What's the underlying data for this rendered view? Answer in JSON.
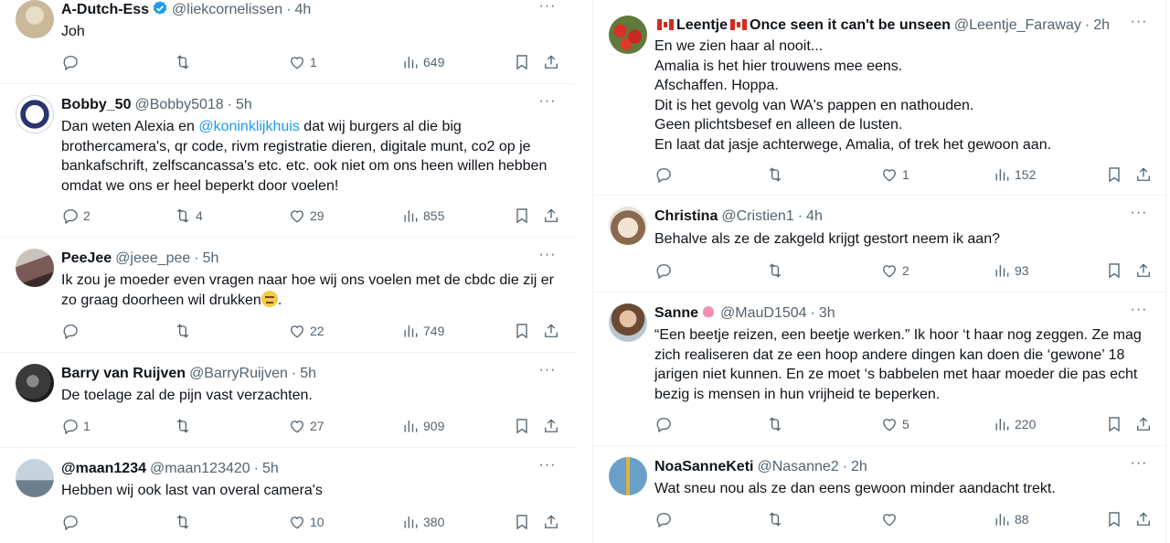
{
  "left_column": {
    "tweets": [
      {
        "name": "A-Dutch-Ess",
        "verified": true,
        "handle": "@liekcornelissen",
        "time": "4h",
        "text": "Joh",
        "replies": "",
        "retweets": "",
        "likes": "1",
        "views": "649",
        "avatar_color": "#c9b89a"
      },
      {
        "name": "Bobby_50",
        "handle": "@Bobby5018",
        "time": "5h",
        "text_before": "Dan weten Alexia en ",
        "mention": "@koninklijkhuis",
        "text_after": " dat wij burgers al die big\nbrothercamera's, qr code, rivm registratie dieren, digitale munt, co2 op je\nbankafschrift, zelfscancassa's etc. etc. ook niet om ons heen willen hebben\nomdat we ons er heel beperkt door voelen!",
        "replies": "2",
        "retweets": "4",
        "likes": "29",
        "views": "855",
        "avatar_color": "#2a3570"
      },
      {
        "name": "PeeJee",
        "handle": "@jeee_pee",
        "time": "5h",
        "text": "Ik zou je moeder even vragen naar hoe wij ons voelen met de cbdc die zij er\nzo graag doorheen wil drukken",
        "text_end": ".",
        "replies": "",
        "retweets": "",
        "likes": "22",
        "views": "749",
        "avatar_color": "#7a5a55"
      },
      {
        "name": "Barry van Ruijven",
        "handle": "@BarryRuijven",
        "time": "5h",
        "text": "De toelage zal de pijn vast verzachten.",
        "replies": "1",
        "retweets": "",
        "likes": "27",
        "views": "909",
        "avatar_color": "#3a3a3a"
      },
      {
        "name": "@maan1234",
        "handle": "@maan123420",
        "time": "5h",
        "text": "Hebben wij ook last van overal camera's",
        "replies": "",
        "retweets": "",
        "likes": "10",
        "views": "380",
        "avatar_color": "#8fa5b8"
      }
    ]
  },
  "right_column": {
    "tweets": [
      {
        "name": "Leentje",
        "name_suffix": "Once seen it can't be unseen",
        "handle": "@Leentje_Faraway",
        "time": "2h",
        "text": "En we zien haar al nooit...\nAmalia is het hier trouwens mee eens.\nAfschaffen. Hoppa.\nDit is het gevolg van WA's pappen en nathouden.\nGeen plichtsbesef en alleen de lusten.\nEn laat dat jasje achterwege, Amalia, of trek het gewoon aan.",
        "replies": "",
        "retweets": "",
        "likes": "1",
        "views": "152",
        "avatar_color": "#b33a2a"
      },
      {
        "name": "Christina",
        "handle": "@Cristien1",
        "time": "4h",
        "text": "Behalve als ze de zakgeld krijgt gestort neem ik aan?",
        "replies": "",
        "retweets": "",
        "likes": "2",
        "views": "93",
        "avatar_color": "#d9c7b3"
      },
      {
        "name": "Sanne",
        "handle": "@MauD1504",
        "time": "3h",
        "text": "“Een beetje reizen, een beetje werken.” Ik hoor ‘t haar nog zeggen. Ze mag\nzich realiseren dat ze een hoop andere dingen kan doen die ‘gewone’ 18\njarigen niet kunnen. En ze moet ‘s babbelen met haar moeder die pas echt\nbezig is mensen in hun vrijheid te beperken.",
        "replies": "",
        "retweets": "",
        "likes": "5",
        "views": "220",
        "avatar_color": "#a8896c"
      },
      {
        "name": "NoaSanneKeti",
        "handle": "@Nasanne2",
        "time": "2h",
        "text": "Wat sneu nou als ze dan eens gewoon minder aandacht trekt.",
        "replies": "",
        "retweets": "",
        "likes": "",
        "views": "88",
        "avatar_color": "#6aa0c8"
      }
    ]
  },
  "icons": {
    "reply": "reply-icon",
    "retweet": "retweet-icon",
    "like": "heart-icon",
    "views": "views-icon",
    "bookmark": "bookmark-icon",
    "share": "share-icon",
    "more": "more-icon"
  },
  "colors": {
    "text": "#0f1419",
    "secondary": "#536471",
    "link": "#1d9bf0",
    "divider": "#eff3f4"
  }
}
